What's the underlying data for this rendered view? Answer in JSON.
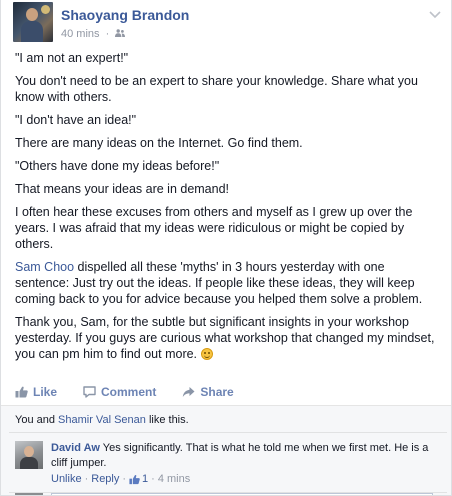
{
  "post": {
    "author": "Shaoyang Brandon",
    "time": "40 mins",
    "separator": "·",
    "audience_icon": "friends-icon",
    "options_icon": "chevron-down-icon",
    "paragraphs": [
      "\"I am not an expert!\"",
      "You don't need to be an expert to share your knowledge. Share what you know with others.",
      "\"I don't have an idea!\"",
      "There are many ideas on the Internet. Go find them.",
      "\"Others have done my ideas before!\"",
      "That means your ideas are in demand!",
      "I often hear these excuses from others and myself as I grew up over the years. I was afraid that my ideas were ridiculous or might be copied by others."
    ],
    "mention": "Sam Choo",
    "mention_rest": " dispelled all these 'myths' in 3 hours yesterday with one sentence: Just try out the ideas. If people like these ideas, they will keep coming back to you for advice because you helped them solve a problem.",
    "closing": "Thank you, Sam, for the subtle but significant insights in your workshop yesterday. If you guys are curious what workshop that changed my mindset, you can pm him to find out more. ",
    "closing_emoji": "smile-emoji"
  },
  "actions": {
    "like": "Like",
    "comment": "Comment",
    "share": "Share"
  },
  "likes": {
    "you": "You and ",
    "other": "Shamir Val Senan",
    "suffix": " like this."
  },
  "comment": {
    "author": "David Aw",
    "text": " Yes significantly. That is what he told me when we first met. He is a cliff jumper.",
    "unlike": "Unlike",
    "reply": "Reply",
    "like_count": "1",
    "time": "4 mins",
    "sep": "·"
  },
  "colors": {
    "link": "#3b5998",
    "muted": "#9197a3",
    "action": "#7f7f7f"
  }
}
